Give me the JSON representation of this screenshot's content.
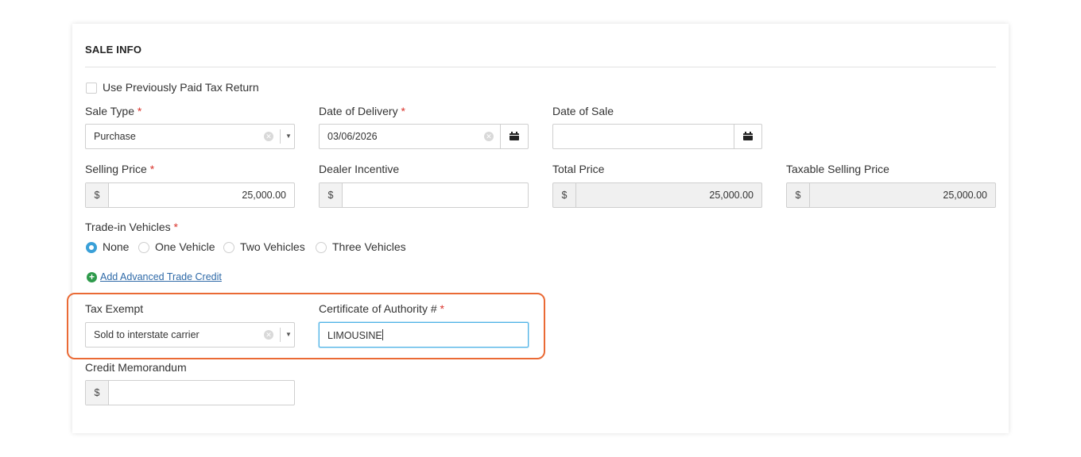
{
  "section": {
    "title": "SALE INFO"
  },
  "use_prev_tax": {
    "label": "Use Previously Paid Tax Return",
    "checked": false
  },
  "required_mark": "*",
  "sale_type": {
    "label": "Sale Type",
    "value": "Purchase"
  },
  "date_of_delivery": {
    "label": "Date of Delivery",
    "value": "03/06/2026"
  },
  "date_of_sale": {
    "label": "Date of Sale",
    "value": ""
  },
  "selling_price": {
    "label": "Selling Price",
    "prefix": "$",
    "value": "25,000.00"
  },
  "dealer_incentive": {
    "label": "Dealer Incentive",
    "prefix": "$",
    "value": ""
  },
  "total_price": {
    "label": "Total Price",
    "prefix": "$",
    "value": "25,000.00"
  },
  "taxable_selling_price": {
    "label": "Taxable Selling Price",
    "prefix": "$",
    "value": "25,000.00"
  },
  "trade_in": {
    "label": "Trade-in Vehicles",
    "options": [
      "None",
      "One Vehicle",
      "Two Vehicles",
      "Three Vehicles"
    ],
    "selected": "None"
  },
  "advanced_trade_credit": {
    "label": "Add Advanced Trade Credit"
  },
  "tax_exempt": {
    "label": "Tax Exempt",
    "value": "Sold to interstate carrier"
  },
  "certificate_of_authority": {
    "label": "Certificate of Authority #",
    "value": "LIMOUSINE"
  },
  "credit_memorandum": {
    "label": "Credit Memorandum",
    "prefix": "$",
    "value": ""
  },
  "colors": {
    "required": "#d9332b",
    "highlight": "#ea6a35",
    "radio_selected": "#3aa0d8",
    "add_icon": "#2e9a4b",
    "link": "#2f6aa8"
  }
}
